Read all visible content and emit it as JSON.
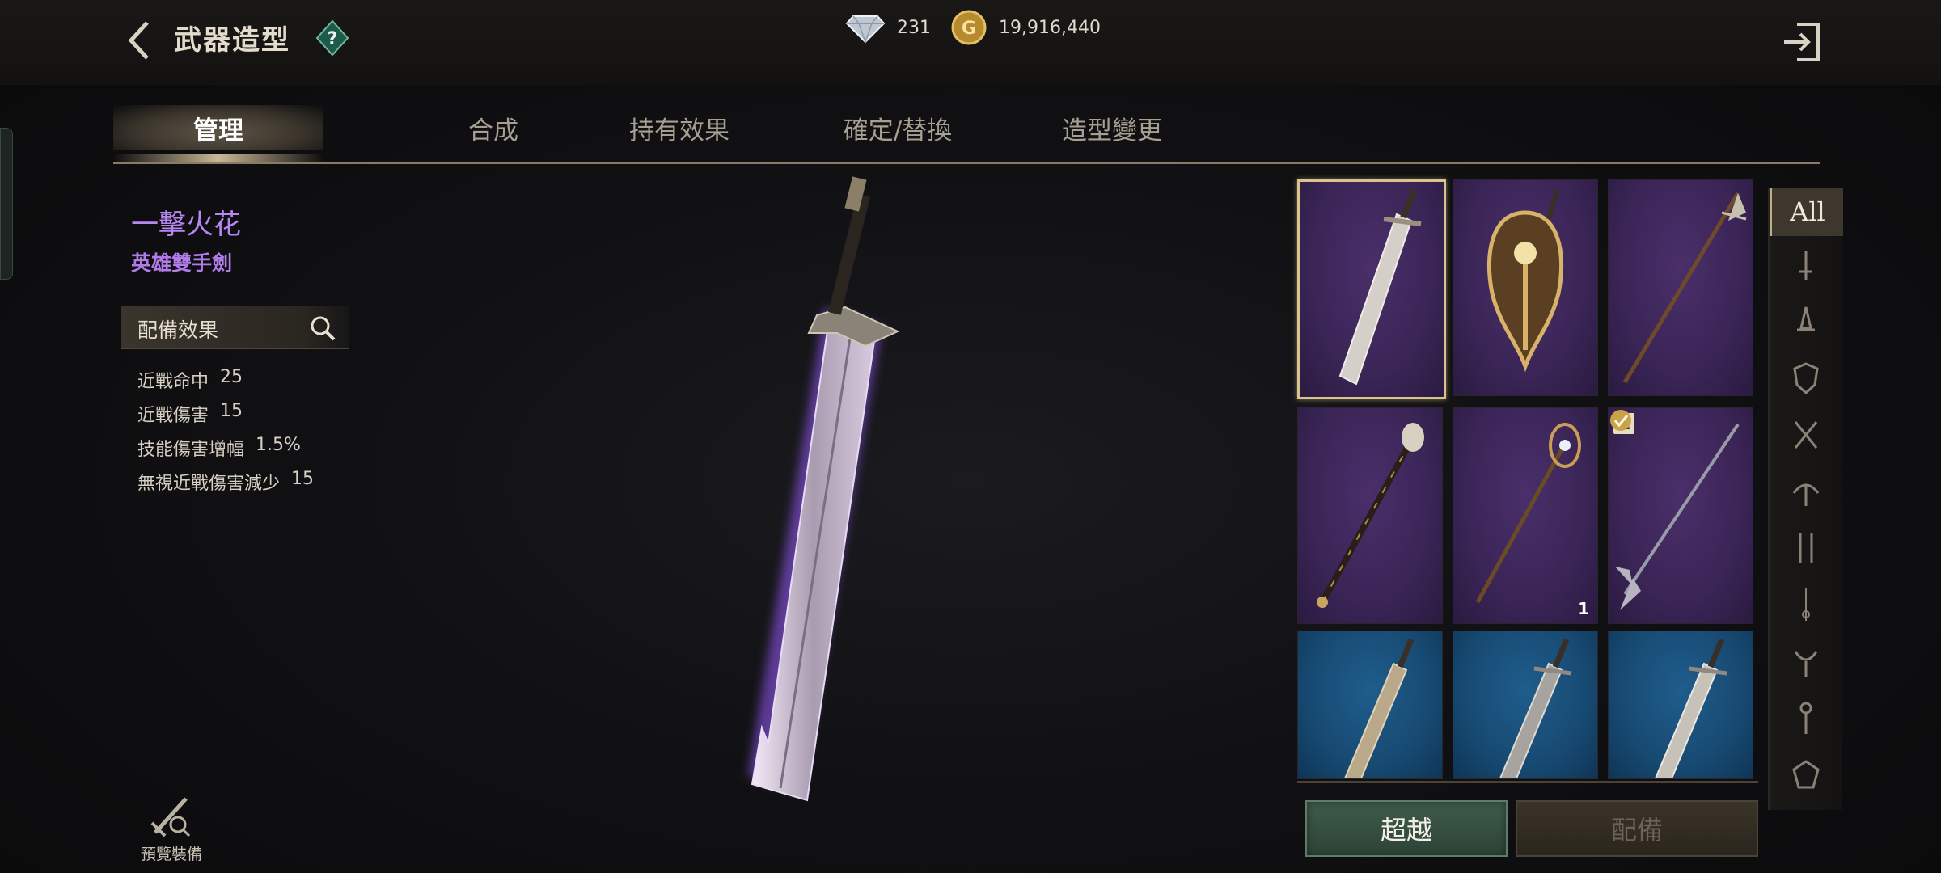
{
  "header": {
    "title": "武器造型",
    "gems": "231",
    "gold": "19,916,440"
  },
  "tabs": [
    {
      "label": "管理",
      "active": true
    },
    {
      "label": "合成",
      "active": false
    },
    {
      "label": "持有效果",
      "active": false
    },
    {
      "label": "確定/替換",
      "active": false
    },
    {
      "label": "造型變更",
      "active": false
    }
  ],
  "item": {
    "name": "一擊火花",
    "type": "英雄雙手劍",
    "name_color": "#b787f2"
  },
  "effects": {
    "title": "配備效果",
    "stats": [
      {
        "label": "近戰命中",
        "value": "25"
      },
      {
        "label": "近戰傷害",
        "value": "15"
      },
      {
        "label": "技能傷害增幅",
        "value": "1.5%"
      },
      {
        "label": "無視近戰傷害減少",
        "value": "15"
      }
    ]
  },
  "preview_equip": {
    "label": "預覽裝備"
  },
  "grid": {
    "cells": [
      {
        "weapon": "greatsword",
        "rarity": "purple",
        "selected": true
      },
      {
        "weapon": "shield",
        "rarity": "purple"
      },
      {
        "weapon": "spear",
        "rarity": "purple"
      },
      {
        "weapon": "mace-staff",
        "rarity": "purple"
      },
      {
        "weapon": "orb-staff",
        "rarity": "purple",
        "count": "1"
      },
      {
        "weapon": "halberd",
        "rarity": "purple",
        "badge": "E",
        "checked": true
      },
      {
        "weapon": "greatsword",
        "rarity": "blue"
      },
      {
        "weapon": "greatsword",
        "rarity": "blue"
      },
      {
        "weapon": "greatsword",
        "rarity": "blue"
      }
    ]
  },
  "filters": {
    "all_label": "All",
    "icons": [
      "dagger-icon",
      "sword-icon",
      "shield-icon",
      "crossed-swords-icon",
      "bow-icon",
      "dual-blades-icon",
      "rapier-icon",
      "scythe-icon",
      "staff-icon",
      "emblem-icon"
    ]
  },
  "buttons": {
    "transcend": "超越",
    "equip": "配備"
  },
  "colors": {
    "accent_gold": "#c9b896",
    "epic_purple": "#3a2556",
    "rare_blue": "#174a72"
  }
}
